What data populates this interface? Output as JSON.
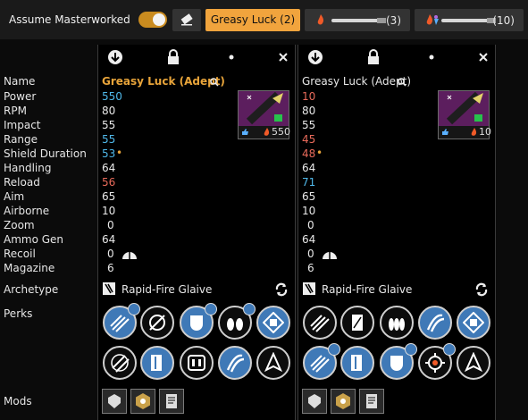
{
  "toolbar": {
    "assume_masterworked_label": "Assume Masterworked",
    "tabs": [
      {
        "label": "Greasy Luck (2)"
      },
      {
        "count": "(3)"
      },
      {
        "count": "(10)"
      }
    ]
  },
  "stat_labels": [
    "Name",
    "Power",
    "RPM",
    "Impact",
    "Range",
    "Shield Duration",
    "Handling",
    "Reload",
    "Aim",
    "Airborne",
    "Zoom",
    "Ammo Gen",
    "Recoil",
    "Magazine",
    "Archetype",
    "Perks",
    "Mods"
  ],
  "items": [
    {
      "name": "Greasy Luck (Adept)",
      "stats": {
        "power": "550",
        "rpm": "80",
        "impact": "55",
        "range": "55",
        "shield": "53",
        "handling": "64",
        "reload": "56",
        "aim": "65",
        "airborne": "10",
        "zoom": "0",
        "ammo_gen": "64",
        "recoil": "0",
        "magazine": "6"
      },
      "power_level": "550",
      "archetype": "Rapid-Fire Glaive"
    },
    {
      "name": "Greasy Luck (Adept)",
      "stats": {
        "power": "10",
        "rpm": "80",
        "impact": "55",
        "range": "45",
        "shield": "48",
        "handling": "64",
        "reload": "71",
        "aim": "65",
        "airborne": "10",
        "zoom": "0",
        "ammo_gen": "64",
        "recoil": "0",
        "magazine": "6"
      },
      "power_level": "10",
      "archetype": "Rapid-Fire Glaive"
    }
  ],
  "colors": {
    "accent": "#f1a43d",
    "perk_blue": "#3f79b7",
    "stat_blue": "#4fb7e8",
    "stat_red": "#e86a5a"
  }
}
